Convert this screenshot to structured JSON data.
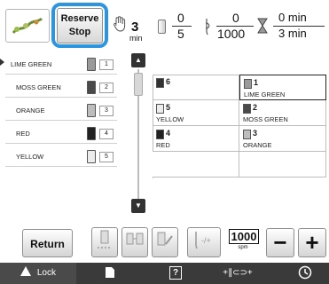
{
  "top": {
    "reserve_stop_line1": "Reserve",
    "reserve_stop_line2": "Stop",
    "color_changes": "3",
    "time_unit": "min",
    "stops_done": "0",
    "stops_total": "5",
    "stitches_done": "0",
    "stitches_total": "1000",
    "time_done": "0 min",
    "time_total": "3 min"
  },
  "thread_list": [
    {
      "name": "LIME GREEN",
      "num": "1",
      "color": "#9a9a9a"
    },
    {
      "name": "MOSS GREEN",
      "num": "2",
      "color": "#4a4a4a"
    },
    {
      "name": "ORANGE",
      "num": "3",
      "color": "#bdbdbd"
    },
    {
      "name": "RED",
      "num": "4",
      "color": "#222222"
    },
    {
      "name": "YELLOW",
      "num": "5",
      "color": "#ececec"
    }
  ],
  "sequence": [
    {
      "num": "6",
      "label": "",
      "color": "#333333"
    },
    {
      "num": "1",
      "label": "LIME GREEN",
      "color": "#9a9a9a"
    },
    {
      "num": "5",
      "label": "YELLOW",
      "color": "#ececec"
    },
    {
      "num": "2",
      "label": "MOSS GREEN",
      "color": "#4a4a4a"
    },
    {
      "num": "4",
      "label": "RED",
      "color": "#222222"
    },
    {
      "num": "3",
      "label": "ORANGE",
      "color": "#bdbdbd"
    }
  ],
  "controls": {
    "return_label": "Return",
    "speed_value": "1000",
    "speed_unit": "spm",
    "minus_label": "−",
    "plus_label": "+"
  },
  "status": {
    "lock_label": "Lock",
    "help_label": "?",
    "presser_label": "+∥⊂⊃+"
  },
  "colors": {
    "highlight": "#2b95e0",
    "status_bar": "#3a3a3a"
  }
}
